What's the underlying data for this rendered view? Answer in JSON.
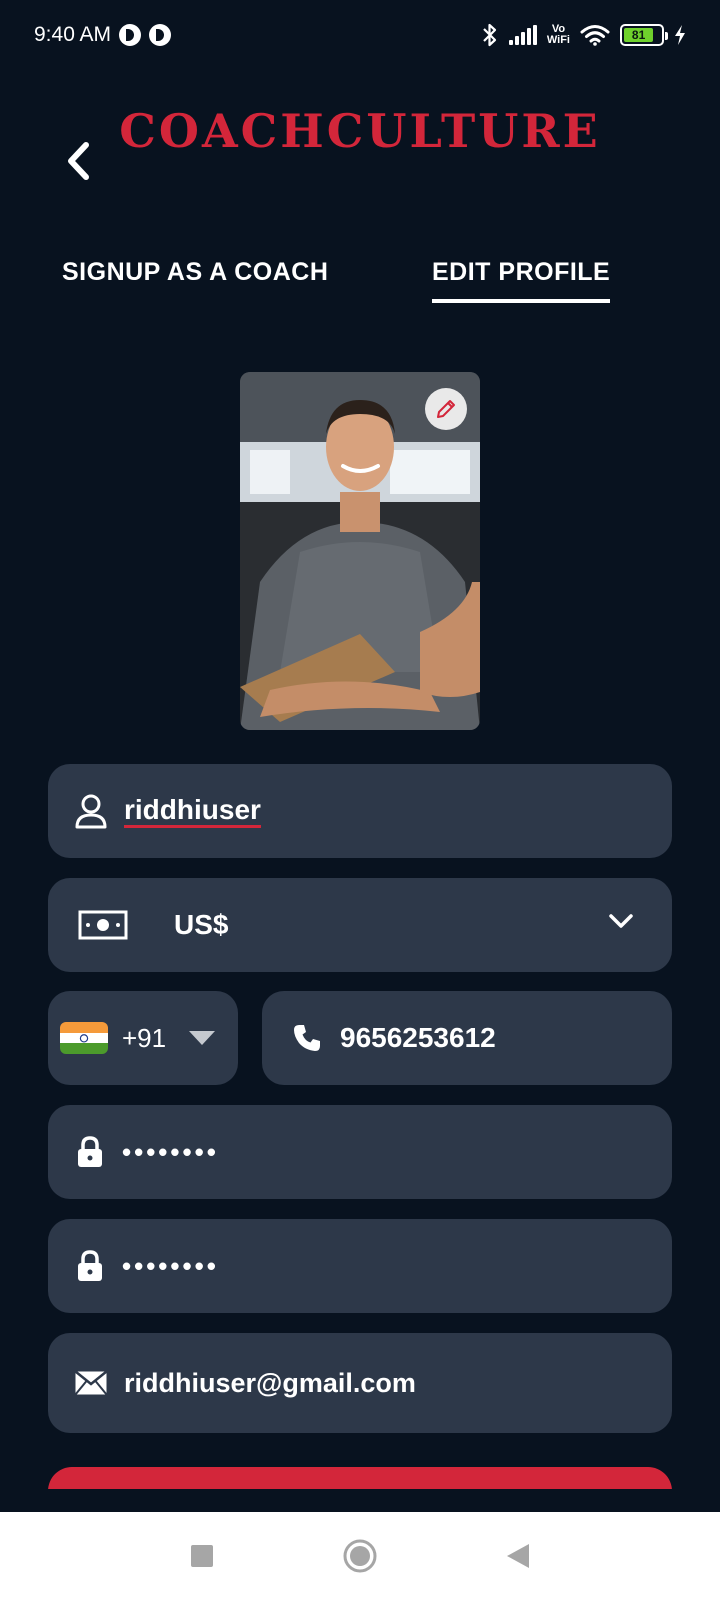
{
  "status_bar": {
    "time": "9:40 AM",
    "network_label_top": "Vo",
    "network_label_bottom": "WiFi",
    "battery_level": "81",
    "icons": [
      "app-circle-icon",
      "app-circle-icon",
      "bluetooth-icon",
      "signal-icon",
      "wifi-icon",
      "battery-icon",
      "charging-icon"
    ]
  },
  "header": {
    "brand": "COACHCULTURE",
    "back_icon": "chevron-left-icon"
  },
  "tabs": [
    {
      "label": "SIGNUP AS A COACH",
      "active": false
    },
    {
      "label": "EDIT PROFILE",
      "active": true
    }
  ],
  "profile": {
    "edit_icon": "pencil-icon"
  },
  "form": {
    "username": "riddhiuser",
    "currency": "US$",
    "country_flag": "india-flag",
    "dial_code": "+91",
    "phone": "9656253612",
    "password": "••••••••",
    "confirm_password": "••••••••",
    "email": "riddhiuser@gmail.com"
  },
  "colors": {
    "background": "#08121f",
    "field": "#2d3849",
    "accent": "#d3263a",
    "text": "#ffffff"
  },
  "nav_bar": {
    "icons": [
      "recent-apps-icon",
      "home-icon",
      "back-icon"
    ]
  }
}
